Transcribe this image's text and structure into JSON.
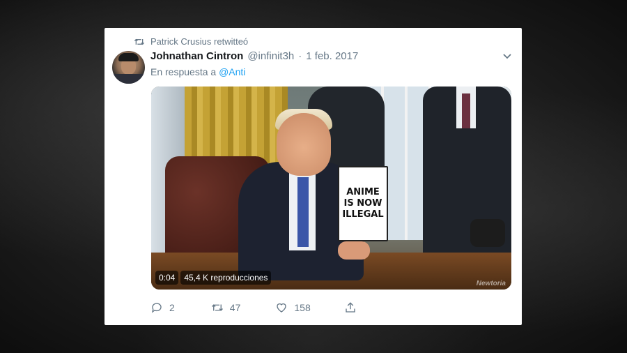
{
  "retweet": {
    "text": "Patrick Crusius retwitteó"
  },
  "tweet": {
    "name": "Johnathan Cintron",
    "handle": "@infinit3h",
    "separator": "·",
    "date": "1 feb. 2017",
    "reply_prefix": "En respuesta a",
    "reply_to": "@Anti"
  },
  "media": {
    "sign_lines": [
      "ANIME",
      "IS NOW",
      "ILLEGAL"
    ],
    "watermark": "Newtoria",
    "duration": "0:04",
    "views": "45,4 K reproducciones"
  },
  "actions": {
    "reply_count": "2",
    "retweet_count": "47",
    "like_count": "158"
  },
  "colors": {
    "link": "#1da1f2",
    "muted": "#657786",
    "text": "#14171a"
  }
}
